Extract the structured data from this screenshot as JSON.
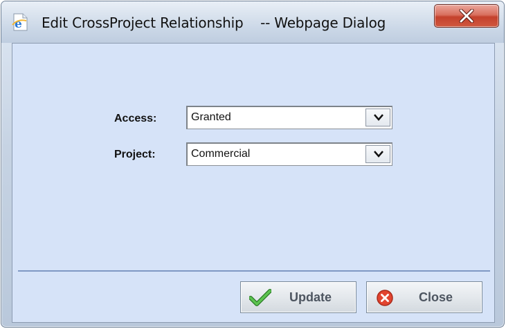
{
  "window": {
    "title": "Edit CrossProject Relationship    -- Webpage Dialog",
    "title_icon": "ie-page-icon",
    "close_icon": "close-x-icon"
  },
  "form": {
    "access": {
      "label": "Access:",
      "value": "Granted"
    },
    "project": {
      "label": "Project:",
      "value": "Commercial"
    }
  },
  "buttons": {
    "update": {
      "label": "Update",
      "icon": "checkmark-icon"
    },
    "close": {
      "label": "Close",
      "icon": "red-x-circle-icon"
    }
  },
  "colors": {
    "client_bg": "#d6e3f8",
    "divider": "#7f98c4",
    "close_button": "#c4412c",
    "update_check": "#3fa33a",
    "close_circle": "#e2442f"
  }
}
